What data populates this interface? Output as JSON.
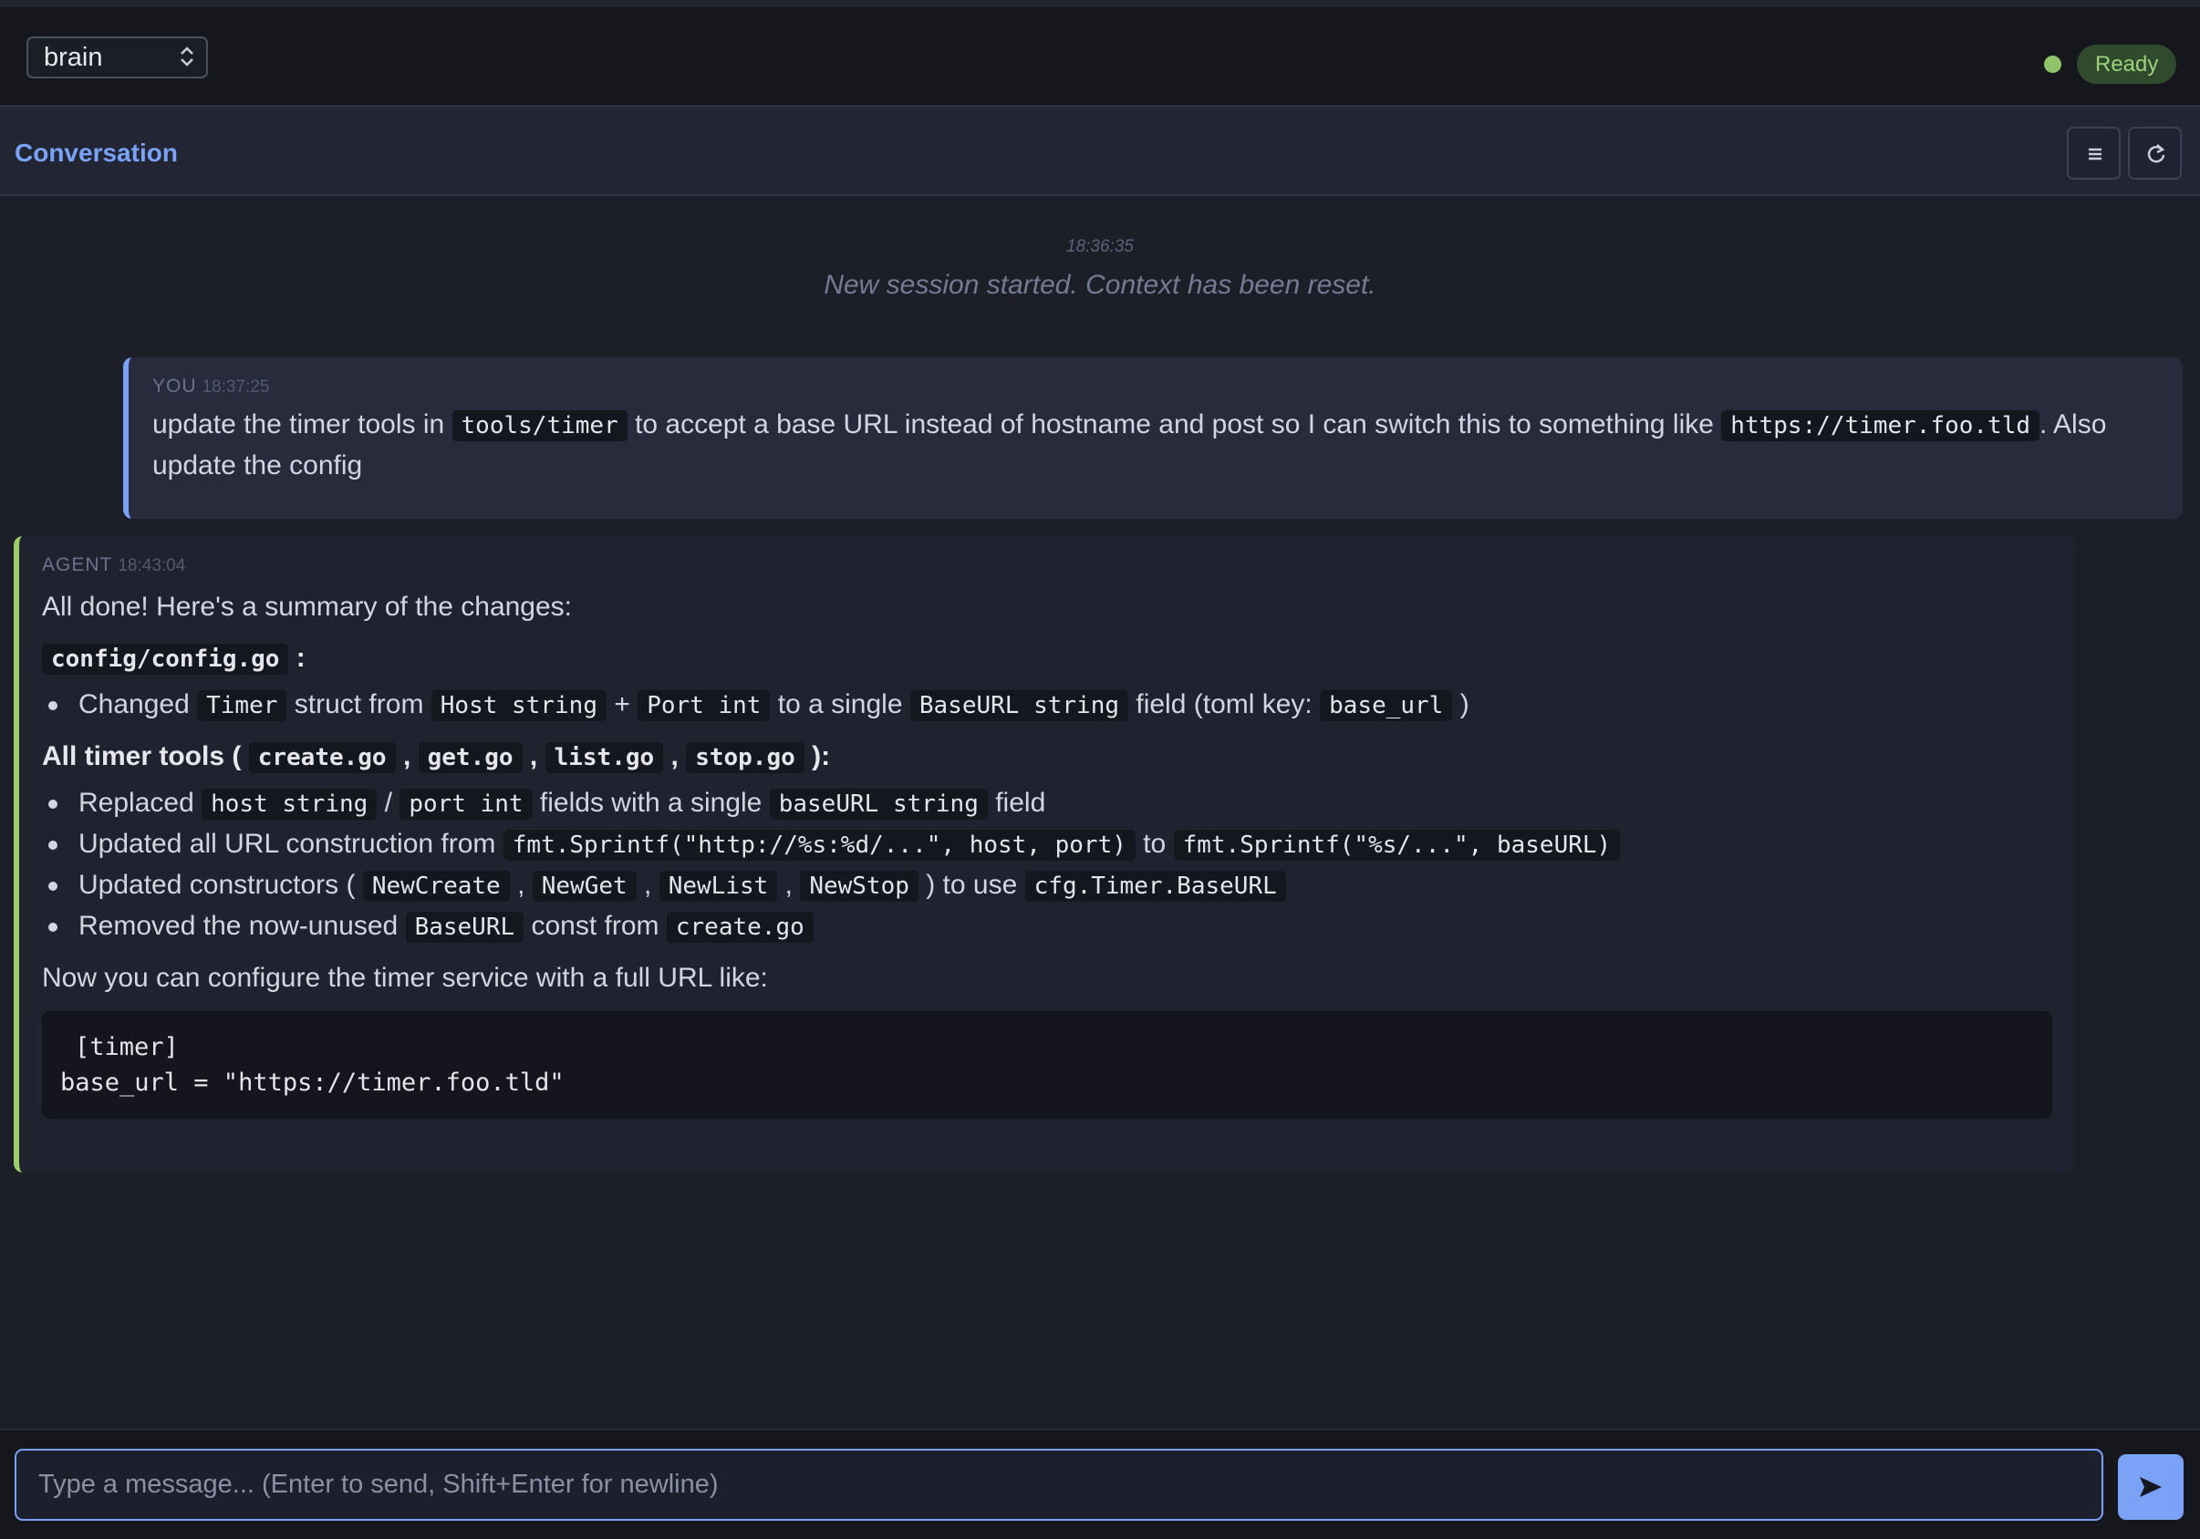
{
  "topbar": {
    "model_value": "brain",
    "status_label": "Ready",
    "status_color": "#8fc46a"
  },
  "conversation": {
    "title": "Conversation",
    "menu_icon": "hamburger-icon",
    "refresh_icon": "refresh-icon"
  },
  "system": {
    "time": "18:36:35",
    "text": "New session started. Context has been reset."
  },
  "user_message": {
    "role": "YOU",
    "time": "18:37:25",
    "t1": "update the timer tools in",
    "c1": "tools/timer",
    "t2": "to accept a base URL instead of hostname and post so I can switch this to something like",
    "c2": "https://timer.foo.tld",
    "t3": ". Also update the config"
  },
  "agent_message": {
    "role": "AGENT",
    "time": "18:43:04",
    "intro": "All done! Here's a summary of the changes:",
    "section1": {
      "file": "config/config.go",
      "colon": ":"
    },
    "bullet1": {
      "t1": "Changed",
      "c1": "Timer",
      "t2": "struct from",
      "c2": "Host string",
      "t3": "+",
      "c3": "Port int",
      "t4": "to a single",
      "c4": "BaseURL string",
      "t5": "field (toml key:",
      "c5": "base_url",
      "t6": ")"
    },
    "section2": {
      "prefix": "All timer tools (",
      "f1": "create.go",
      "sep": ",",
      "f2": "get.go",
      "f3": "list.go",
      "f4": "stop.go",
      "suffix": "):"
    },
    "b2": {
      "t1": "Replaced",
      "c1": "host string",
      "t2": "/",
      "c2": "port int",
      "t3": "fields with a single",
      "c3": "baseURL string",
      "t4": "field"
    },
    "b3": {
      "t1": "Updated all URL construction from",
      "c1": "fmt.Sprintf(\"http://%s:%d/...\", host, port)",
      "t2": "to",
      "c2": "fmt.Sprintf(\"%s/...\", baseURL)"
    },
    "b4": {
      "t1": "Updated constructors (",
      "c1": "NewCreate",
      "sep": ",",
      "c2": "NewGet",
      "c3": "NewList",
      "c4": "NewStop",
      "t2": ") to use",
      "c5": "cfg.Timer.BaseURL"
    },
    "b5": {
      "t1": "Removed the now-unused",
      "c1": "BaseURL",
      "t2": "const from",
      "c2": "create.go"
    },
    "outro": "Now you can configure the timer service with a full URL like:",
    "code_line1": "[timer]",
    "code_line2": "base_url = \"https://timer.foo.tld\""
  },
  "input": {
    "placeholder": "Type a message... (Enter to send, Shift+Enter for newline)",
    "send_icon": "send-icon"
  }
}
